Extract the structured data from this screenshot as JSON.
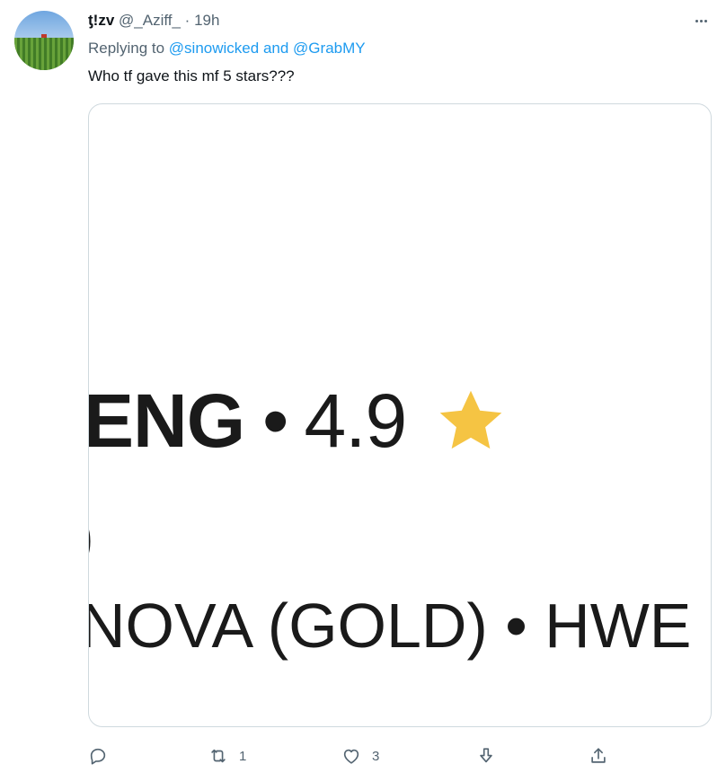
{
  "tweet": {
    "author_name": "ƫ!zv",
    "handle": "@_Aziff_",
    "separator": "·",
    "time": "19h",
    "reply_prefix": "Replying to",
    "reply_mention_1": "@sinowicked",
    "reply_and": "and",
    "reply_mention_2": "@GrabMY",
    "text": "Who tf gave this mf 5 stars???"
  },
  "media": {
    "line1_word": "ENG",
    "line1_bullet": "•",
    "line1_rating": "4.9",
    "line2": ")",
    "line3": "NOVA (GOLD) • HWE",
    "star_color": "#f5c443"
  },
  "actions": {
    "reply_count": "",
    "retweet_count": "1",
    "like_count": "3",
    "icons": [
      "reply-icon",
      "retweet-icon",
      "like-icon",
      "share-icon",
      "upload-icon"
    ]
  },
  "colors": {
    "accent": "#1d9bf0",
    "secondary_text": "#536471",
    "border": "#cfd9de"
  }
}
